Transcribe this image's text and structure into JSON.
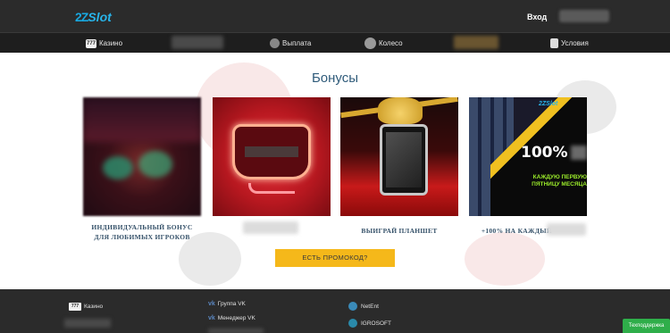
{
  "header": {
    "logo_prefix": "2Z",
    "logo_text": "Slot",
    "login_label": "Вход"
  },
  "nav": {
    "items": [
      {
        "label": "Казино",
        "icon": "slot-777-icon",
        "icon_text": "777"
      },
      {
        "label": "Выплата",
        "icon": "coin-icon"
      },
      {
        "label": "Колесо",
        "icon": "wheel-icon"
      },
      {
        "label": "Условия",
        "icon": "document-icon"
      }
    ]
  },
  "main": {
    "title": "Бонусы",
    "cards": [
      {
        "label": "ИНДИВИДУАЛЬНЫЙ БОНУС ДЛЯ ЛЮБИМЫХ ИГРОКОВ"
      },
      {
        "label": ""
      },
      {
        "label": "ВЫИГРАЙ ПЛАНШЕТ"
      },
      {
        "label": "+100% НА КАЖДЫЙ",
        "banner_tag": "2ZSlot",
        "banner_big": "100%",
        "banner_sub": "КАЖДУЮ ПЕРВУЮ ПЯТНИЦУ МЕСЯЦА"
      }
    ],
    "promo_button": "ЕСТЬ ПРОМОКОД?"
  },
  "footer": {
    "casino_label": "Казино",
    "casino_icon_text": "777",
    "vk_group": "Группа VK",
    "vk_manager": "Менеджер VK",
    "providers": [
      "NetEnt",
      "IGROSOFT"
    ],
    "support_label": "Техподдержка"
  },
  "colors": {
    "header_bg": "#2b2b2b",
    "accent_blue": "#28b4ea",
    "title_color": "#2f5b7a",
    "promo_yellow": "#f5b81a",
    "support_green": "#2fae4a"
  }
}
